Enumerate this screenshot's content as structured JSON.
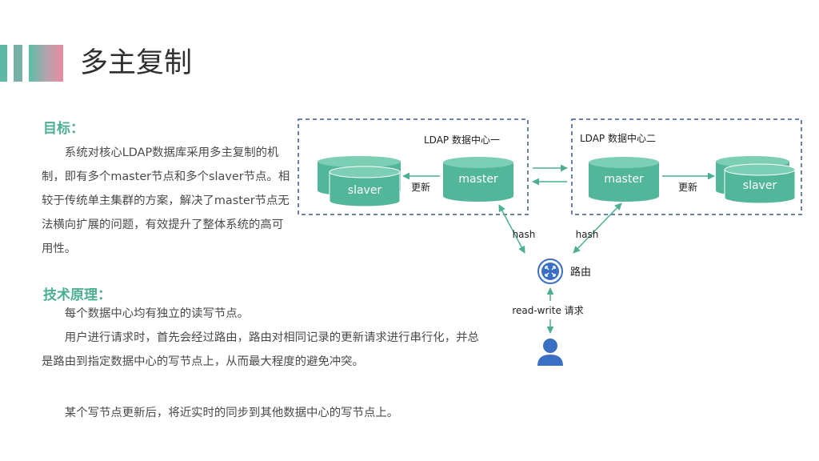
{
  "header": {
    "title": "多主复制"
  },
  "goal": {
    "heading": "目标：",
    "text": "系统对核心LDAP数据库采用多主复制的机制，即有多个master节点和多个slaver节点。相较于传统单主集群的方案，解决了master节点无法横向扩展的问题，有效提升了整体系统的高可用性。"
  },
  "tech": {
    "heading": "技术原理：",
    "p1": "每个数据中心均有独立的读写节点。",
    "p2": "用户进行请求时，首先会经过路由，路由对相同记录的更新请求进行串行化，并总是路由到指定数据中心的写节点上，从而最大程度的避免冲突。",
    "p3": "某个写节点更新后，将近实时的同步到其他数据中心的写节点上。"
  },
  "diagram": {
    "dc1_label": "LDAP 数据中心一",
    "dc2_label": "LDAP 数据中心二",
    "master_label": "master",
    "slaver_label": "slaver",
    "update_label": "更新",
    "hash_label": "hash",
    "router_label": "路由",
    "request_label": "read-write 请求",
    "colors": {
      "accent": "#4caf94",
      "db_fill": "#52b69a",
      "dashed_border": "#3b5a8a",
      "router": "#3a6fc4"
    }
  }
}
